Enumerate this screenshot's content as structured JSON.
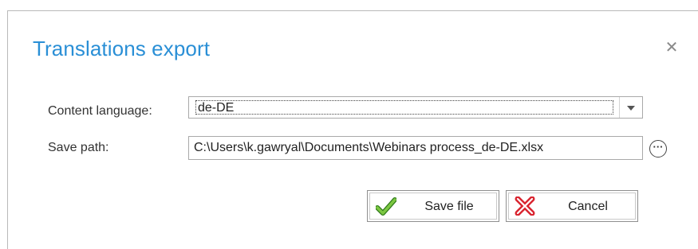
{
  "dialog": {
    "title": "Translations export",
    "close_icon": "close-icon"
  },
  "form": {
    "content_language_label": "Content language:",
    "content_language_value": "de-DE",
    "save_path_label": "Save path:",
    "save_path_value": "C:\\Users\\k.gawryal\\Documents\\Webinars process_de-DE.xlsx",
    "browse_icon": "ellipsis-circle-icon"
  },
  "buttons": {
    "save_label": "Save file",
    "save_icon": "green-checkmark-icon",
    "cancel_label": "Cancel",
    "cancel_icon": "red-x-icon"
  },
  "colors": {
    "title": "#2a8fd6",
    "check": "#5aa832",
    "cancel_x": "#d9232e"
  }
}
